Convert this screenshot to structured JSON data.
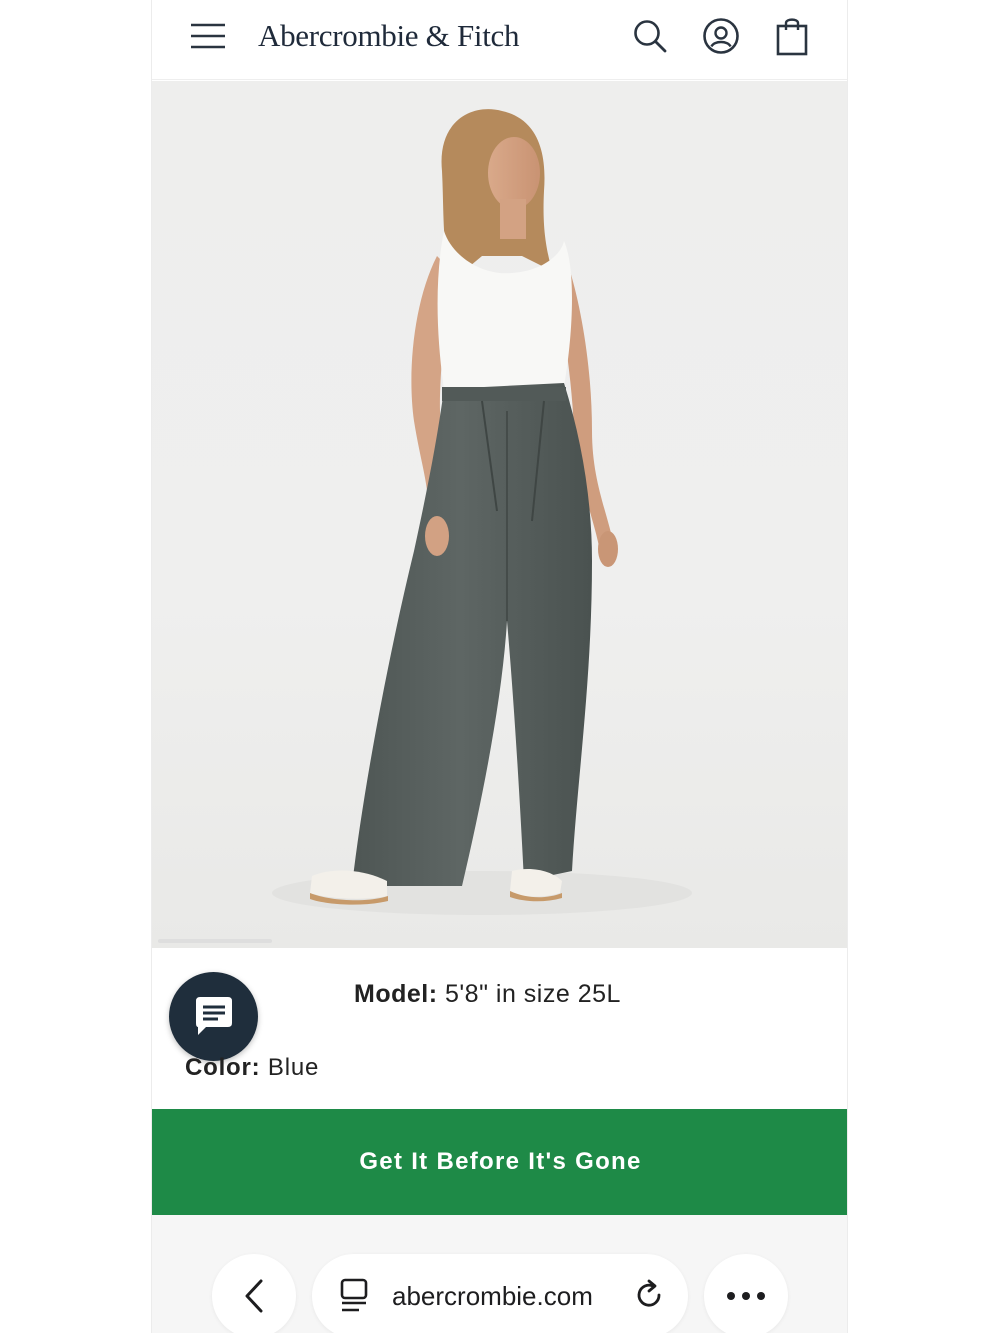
{
  "header": {
    "brand": "Abercrombie & Fitch",
    "icons": [
      "menu-icon",
      "search-icon",
      "account-icon",
      "shopping-bag-icon"
    ]
  },
  "product": {
    "image_alt": "Model wearing grey wide-leg pleated trousers with white tank top",
    "model_label": "Model:",
    "model_value": "5'8\" in size 25L",
    "color_label": "Color:",
    "color_value": "Blue"
  },
  "cta": {
    "label": "Get It Before It's Gone",
    "color": "#1e8a47"
  },
  "browser": {
    "url": "abercrombie.com",
    "icons": [
      "back-icon",
      "tabs-icon",
      "reload-icon",
      "more-icon"
    ]
  },
  "colors": {
    "brand_text": "#1f2a3a",
    "chat_button": "#1f2e3c"
  }
}
